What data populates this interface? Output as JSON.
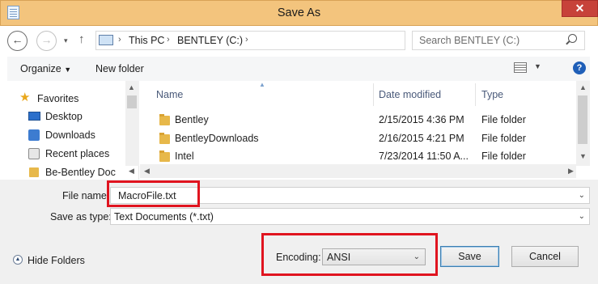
{
  "window": {
    "title": "Save As",
    "close_label": "✕"
  },
  "nav": {
    "breadcrumb": [
      "This PC",
      "BENTLEY (C:)"
    ],
    "search_placeholder": "Search BENTLEY (C:)"
  },
  "toolbar": {
    "organize_label": "Organize",
    "new_folder_label": "New folder"
  },
  "sidebar": {
    "items": [
      {
        "label": "Favorites",
        "icon": "star-icon"
      },
      {
        "label": "Desktop",
        "icon": "desktop-icon"
      },
      {
        "label": "Downloads",
        "icon": "downloads-icon"
      },
      {
        "label": "Recent places",
        "icon": "recent-places-icon"
      },
      {
        "label": "Be-Bentley Doc",
        "icon": "folder-icon"
      }
    ]
  },
  "files": {
    "columns": [
      "Name",
      "Date modified",
      "Type"
    ],
    "rows": [
      {
        "name": "Bentley",
        "date": "2/15/2015 4:36 PM",
        "type": "File folder"
      },
      {
        "name": "BentleyDownloads",
        "date": "2/16/2015 4:21 PM",
        "type": "File folder"
      },
      {
        "name": "Intel",
        "date": "7/23/2014 11:50 A...",
        "type": "File folder"
      }
    ]
  },
  "form": {
    "file_name_label": "File name:",
    "file_name_value": "MacroFile.txt",
    "save_as_type_label": "Save as type:",
    "save_as_type_value": "Text Documents (*.txt)",
    "encoding_label": "Encoding:",
    "encoding_value": "ANSI"
  },
  "footer": {
    "hide_folders_label": "Hide Folders",
    "save_label": "Save",
    "cancel_label": "Cancel"
  },
  "colors": {
    "titlebar": "#f3c47d",
    "close": "#c7423a",
    "highlight": "#e0141f",
    "folder": "#e7b84a"
  }
}
